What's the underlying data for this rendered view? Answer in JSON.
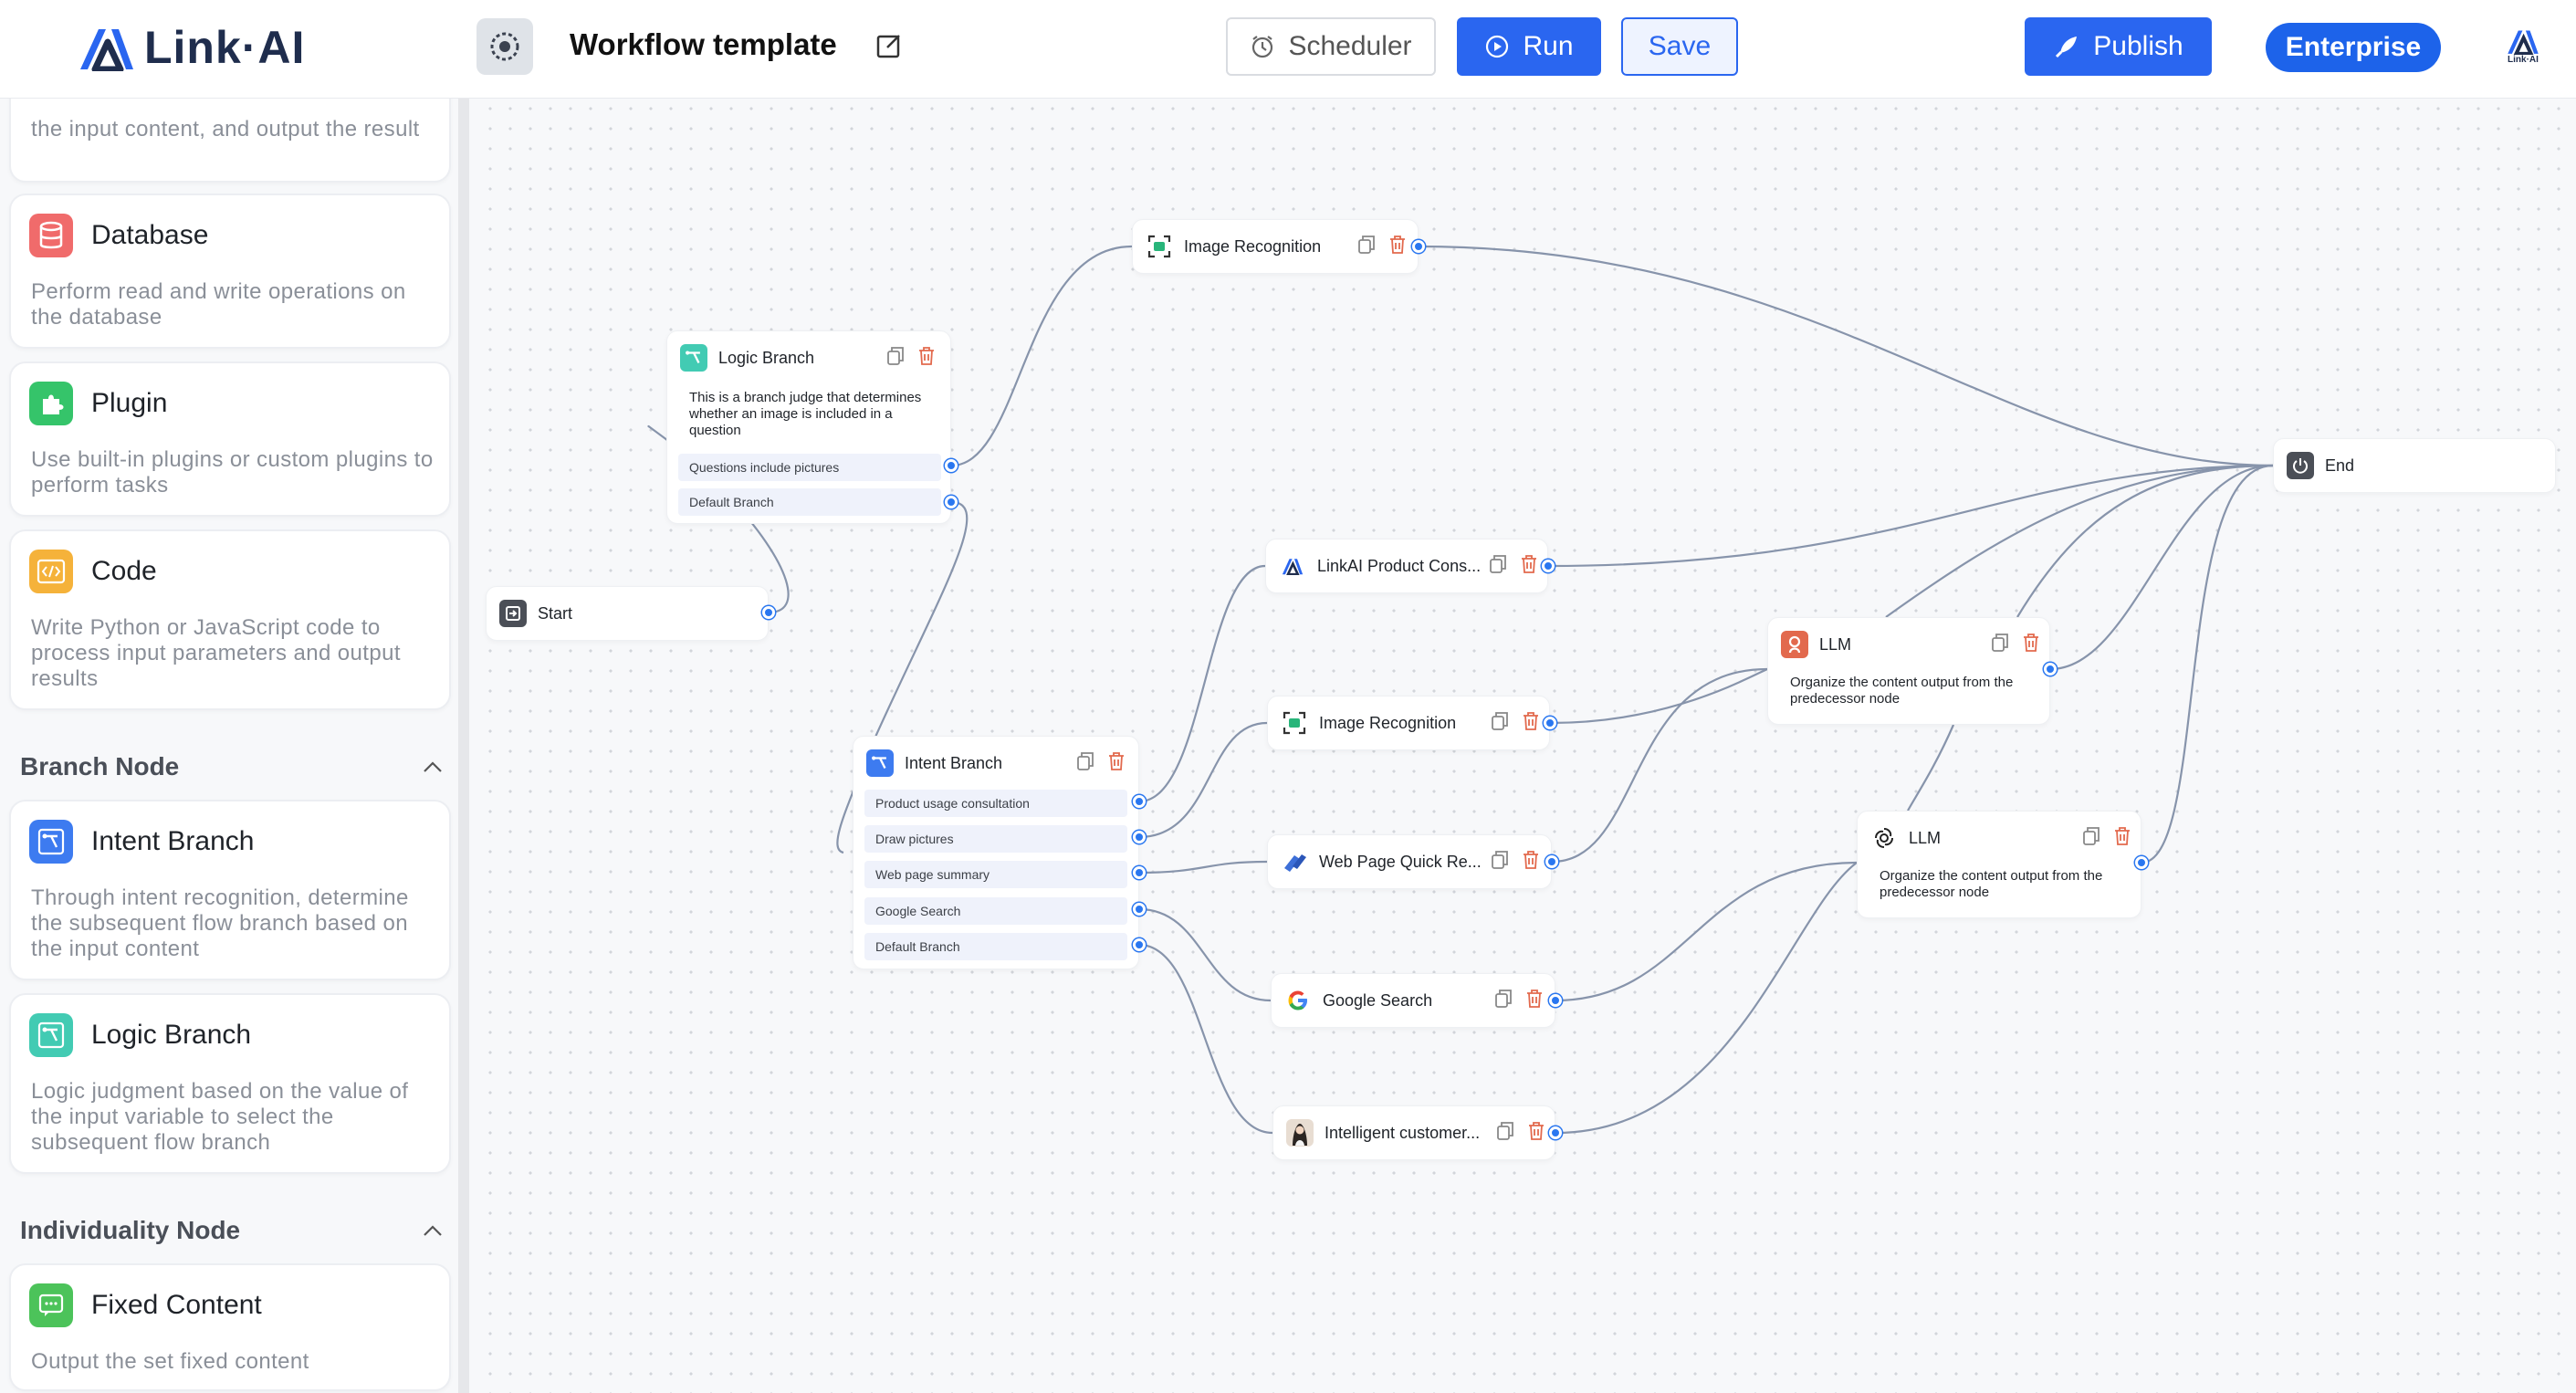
{
  "header": {
    "brand": "Link·AI",
    "title": "Workflow template",
    "scheduler_label": "Scheduler",
    "run_label": "Run",
    "save_label": "Save",
    "publish_label": "Publish",
    "enterprise_label": "Enterprise",
    "avatar_label": "Link·AI"
  },
  "sidebar": {
    "partial_card_desc": "the input content, and output the result",
    "cards": [
      {
        "title": "Database",
        "desc": "Perform read and write operations on the database",
        "icon": "database-icon",
        "color": "#f06b6b"
      },
      {
        "title": "Plugin",
        "desc": "Use built-in plugins or custom plugins to perform tasks",
        "icon": "plugin-icon",
        "color": "#35c46a"
      },
      {
        "title": "Code",
        "desc": "Write Python or JavaScript code to process input parameters and output results",
        "icon": "code-icon",
        "color": "#f5b23a"
      },
      {
        "title": "Intent Branch",
        "desc": "Through intent recognition, determine the subsequent flow branch based on the input content",
        "icon": "intent-branch-icon",
        "color": "#3d7bf0"
      },
      {
        "title": "Logic Branch",
        "desc": "Logic judgment based on the value of the input variable to select the subsequent flow branch",
        "icon": "logic-branch-icon",
        "color": "#42cbb3"
      },
      {
        "title": "Fixed Content",
        "desc": "Output the set fixed content",
        "icon": "chat-icon",
        "color": "#4cc35a"
      }
    ],
    "sections": {
      "branch": "Branch Node",
      "individuality": "Individuality Node"
    }
  },
  "nodes": {
    "start": {
      "title": "Start"
    },
    "end": {
      "title": "End"
    },
    "logic_branch": {
      "title": "Logic Branch",
      "desc": "This is a branch judge that determines whether an image is included in a question",
      "options": [
        "Questions include pictures",
        "Default Branch"
      ]
    },
    "intent_branch": {
      "title": "Intent Branch",
      "options": [
        "Product usage consultation",
        "Draw pictures",
        "Web page summary",
        "Google Search",
        "Default Branch"
      ]
    },
    "image_recognition_top": {
      "title": "Image Recognition"
    },
    "linkai_product": {
      "title": "LinkAI Product Cons..."
    },
    "image_recognition_mid": {
      "title": "Image Recognition"
    },
    "web_page": {
      "title": "Web Page Quick Re..."
    },
    "google_search": {
      "title": "Google Search"
    },
    "intelligent_customer": {
      "title": "Intelligent customer..."
    },
    "llm_1": {
      "title": "LLM",
      "desc": "Organize the content output from the predecessor node"
    },
    "llm_2": {
      "title": "LLM",
      "desc": "Organize the content output from the predecessor node"
    }
  },
  "colors": {
    "accent": "#2a66f0",
    "wire": "#8794ab",
    "port": "#2a77f0",
    "delete": "#e2694d"
  }
}
